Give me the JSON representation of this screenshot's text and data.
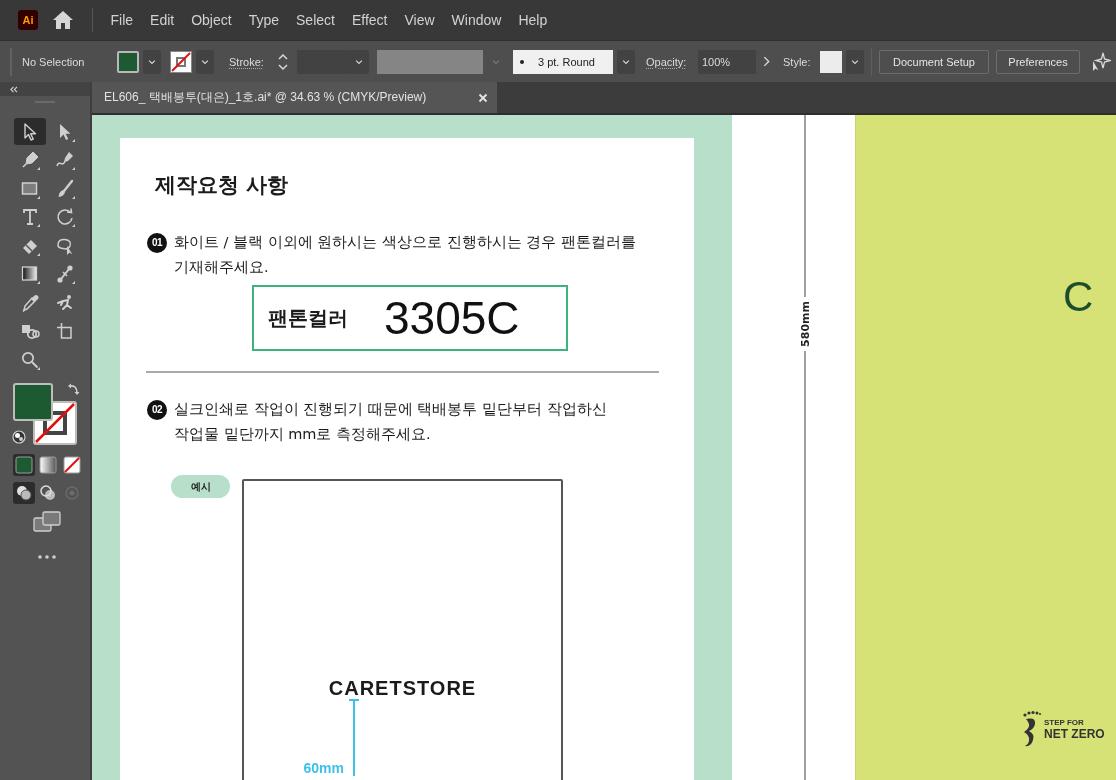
{
  "app": {
    "logo": "Ai"
  },
  "menu": [
    "File",
    "Edit",
    "Object",
    "Type",
    "Select",
    "Effect",
    "View",
    "Window",
    "Help"
  ],
  "control_bar": {
    "selection": "No Selection",
    "stroke_label": "Stroke:",
    "brush": "3 pt. Round",
    "opacity_label": "Opacity:",
    "opacity": "100%",
    "style_label": "Style:",
    "buttons": [
      "Document Setup",
      "Preferences"
    ]
  },
  "document_tab": {
    "title": "EL606_ 택배봉투(대은)_1호.ai* @ 34.63 % (CMYK/Preview)",
    "selected": true
  },
  "toolbox": {
    "tools": [
      {
        "kind": "selection",
        "selected": true
      },
      {
        "kind": "direct_selection",
        "selected": false
      },
      {
        "kind": "pen",
        "selected": false
      },
      {
        "kind": "curvature",
        "selected": false
      },
      {
        "kind": "rectangle",
        "selected": false
      },
      {
        "kind": "paintbrush",
        "selected": false
      },
      {
        "kind": "type",
        "selected": false
      },
      {
        "kind": "rotate",
        "selected": false
      },
      {
        "kind": "eraser",
        "selected": false
      },
      {
        "kind": "shaper",
        "selected": false
      },
      {
        "kind": "gradient",
        "selected": false
      },
      {
        "kind": "width",
        "selected": false
      },
      {
        "kind": "eyedropper",
        "selected": false
      },
      {
        "kind": "puppet_warp",
        "selected": false
      },
      {
        "kind": "shape_builder",
        "selected": false
      },
      {
        "kind": "artboard",
        "selected": false
      },
      {
        "kind": "zoom",
        "selected": false
      }
    ],
    "color_modes": [
      {
        "kind": "color",
        "selected": true
      },
      {
        "kind": "gradient",
        "selected": false
      },
      {
        "kind": "none",
        "selected": false
      }
    ],
    "draw_modes": [
      {
        "kind": "normal",
        "selected": true,
        "disabled": false
      },
      {
        "kind": "behind",
        "selected": false,
        "disabled": false
      },
      {
        "kind": "inside",
        "selected": false,
        "disabled": true
      }
    ]
  },
  "artboard": {
    "title": "제작요청 사항",
    "steps": [
      {
        "number": "01",
        "text": "화이트 / 블랙 이외에 원하시는 색상으로 진행하시는 경우 팬톤컬러를\n기재해주세요."
      },
      {
        "number": "02",
        "text": "실크인쇄로 작업이 진행되기 때문에 택배봉투 밑단부터 작업하신\n작업물 밑단까지 mm로 측정해주세요."
      }
    ],
    "pantone_field": {
      "label": "팬톤컬러",
      "value": "3305C"
    },
    "example": {
      "tag": "예시",
      "logo": "CARETSTORE",
      "measure": "60mm"
    }
  },
  "dimension": {
    "label": "580mm"
  },
  "cover": {
    "logo": "C",
    "net_zero": [
      "STEP FOR",
      "NET ZERO"
    ]
  }
}
